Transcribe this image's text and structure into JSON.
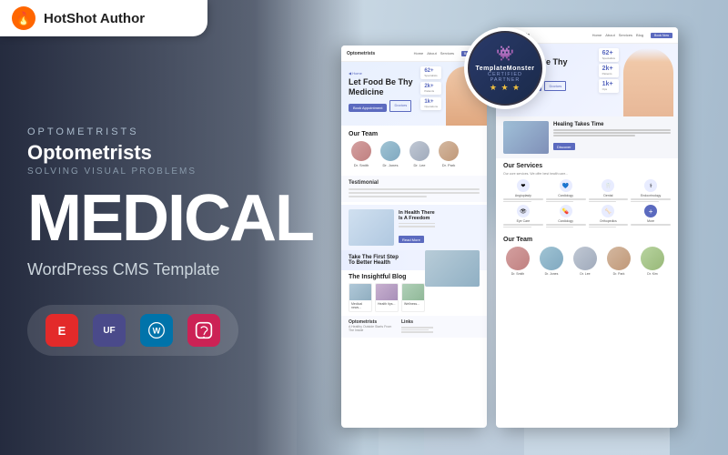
{
  "brand": {
    "name": "HotShot Author",
    "logo_icon": "flame"
  },
  "badge": {
    "brand": "TemplateMonster",
    "line1": "CERTIFIED",
    "line2": "PARTNER",
    "stars": "★ ★ ★"
  },
  "hero": {
    "subtitle": "Optometrists",
    "solving": "SOLVING VISUAL PROBLEMS",
    "main_title": "MEDICAL",
    "sub_title": "WordPress CMS Template"
  },
  "icons": [
    {
      "name": "elementor-icon",
      "label": "E",
      "color": "#e32a2a"
    },
    {
      "name": "uf-icon",
      "label": "UF",
      "color": "#4a4a8a"
    },
    {
      "name": "wordpress-icon",
      "label": "W",
      "color": "#0073aa"
    },
    {
      "name": "quform-icon",
      "label": "Q",
      "color": "#cc2255"
    }
  ],
  "screenshot_left": {
    "site_name": "Optometrists",
    "nav_links": [
      "Home",
      "About",
      "Services",
      "Contact"
    ],
    "hero_title": "Let Food Be Thy Medicine",
    "stats": [
      {
        "number": "62+",
        "label": "Specialists"
      },
      {
        "number": "2k+",
        "label": "Happy Patients"
      },
      {
        "number": "1k+",
        "label": "Operations"
      }
    ],
    "btn_label": "Book Appointment",
    "team_title": "Our Team",
    "members": [
      "Dr. Smith",
      "Dr. Jones",
      "Dr. Lee",
      "Dr. Park"
    ],
    "testimonial_title": "Testimonial",
    "blog_title": "The Insightful Blog",
    "footer_title": "Optometrists",
    "footer_sub": "A Healthy Outside Starts From The Inside"
  },
  "screenshot_right": {
    "site_name": "Optometrists",
    "hero_title": "Let Food Be Thy Medicine",
    "healing_title": "Healing Takes Time",
    "services_title": "Our Services",
    "services_subtitle": "Our core services. We offer best health...",
    "services": [
      {
        "name": "Angioplasty",
        "icon": "❤"
      },
      {
        "name": "Cardiology",
        "icon": "🫀"
      },
      {
        "name": "Dental",
        "icon": "🦷"
      },
      {
        "name": "Endocrinology",
        "icon": "⚕"
      },
      {
        "name": "Eye Care",
        "icon": "👁"
      },
      {
        "name": "Cardiology",
        "icon": "💊"
      },
      {
        "name": "Orthopedics",
        "icon": "🦴"
      },
      {
        "name": "More",
        "icon": "+"
      }
    ],
    "team_title": "Our Team"
  }
}
